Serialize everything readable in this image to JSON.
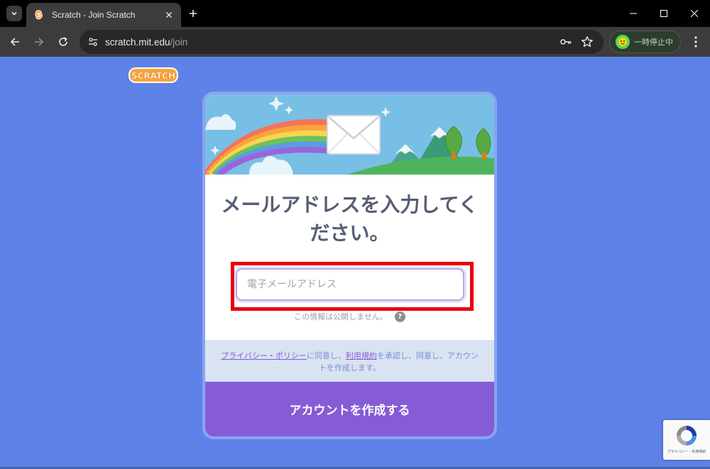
{
  "browser": {
    "tab_title": "Scratch - Join Scratch",
    "url_host": "scratch.mit.edu",
    "url_path": "/join",
    "profile_label": "一時停止中"
  },
  "page": {
    "logo_text": "SCRATCH",
    "title": "メールアドレスを入力してください。",
    "email_placeholder": "電子メールアドレス",
    "privacy_note": "この情報は公開しません。",
    "help_symbol": "?",
    "consent": {
      "privacy_link": "プライバシー・ポリシー",
      "text1": "に同意し、",
      "terms_link": "利用規約",
      "text2": "を承認し、同意し、アカウントを作成します。"
    },
    "submit_label": "アカウントを作成する",
    "recaptcha_text": "プライバシー・利用規約"
  },
  "colors": {
    "page_bg": "#5f82e8",
    "accent_purple": "#855cd6",
    "title_text": "#575e75",
    "highlight_red": "#e8000b"
  }
}
